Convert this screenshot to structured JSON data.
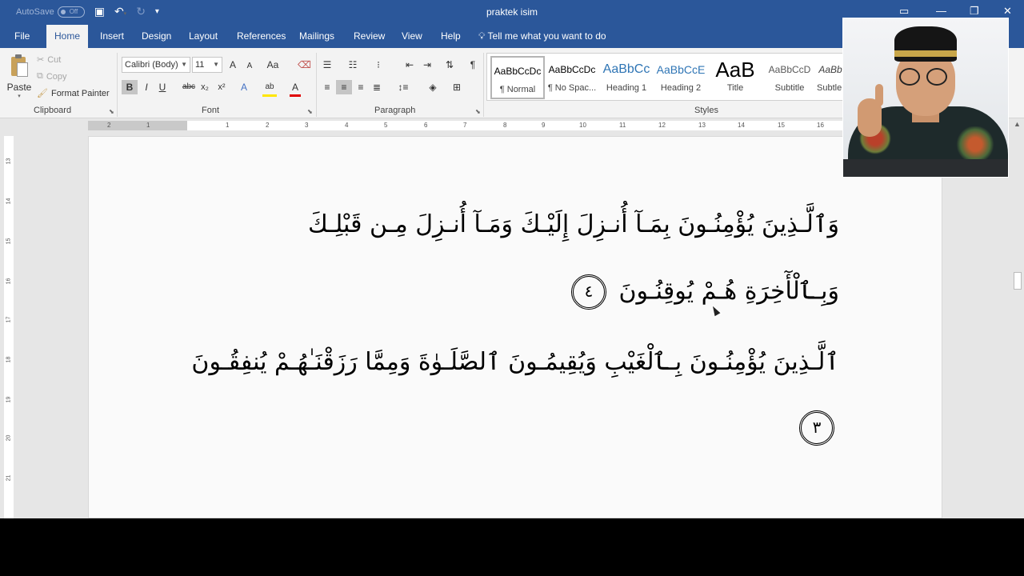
{
  "app": {
    "doc_title": "praktek isim",
    "autosave_label": "AutoSave",
    "autosave_state": "Off"
  },
  "tabs": [
    {
      "label": "File"
    },
    {
      "label": "Home"
    },
    {
      "label": "Insert"
    },
    {
      "label": "Design"
    },
    {
      "label": "Layout"
    },
    {
      "label": "References"
    },
    {
      "label": "Mailings"
    },
    {
      "label": "Review"
    },
    {
      "label": "View"
    },
    {
      "label": "Help"
    }
  ],
  "tell_me": "Tell me what you want to do",
  "clipboard": {
    "paste": "Paste",
    "cut": "Cut",
    "copy": "Copy",
    "format_painter": "Format Painter",
    "group_label": "Clipboard"
  },
  "font": {
    "font_name": "Calibri (Body)",
    "font_size": "11",
    "group_label": "Font",
    "bold": "B",
    "italic": "I",
    "underline": "U",
    "strike": "abc",
    "subscript": "x₂",
    "superscript": "x²",
    "grow": "A",
    "shrink": "A",
    "case": "Aa",
    "effects": "A",
    "highlight": "ab",
    "color": "A"
  },
  "paragraph": {
    "group_label": "Paragraph"
  },
  "styles": {
    "group_label": "Styles",
    "items": [
      {
        "sample": "AaBbCcDc",
        "name": "¶ Normal"
      },
      {
        "sample": "AaBbCcDc",
        "name": "¶ No Spac..."
      },
      {
        "sample": "AaBbCc",
        "name": "Heading 1"
      },
      {
        "sample": "AaBbCcE",
        "name": "Heading 2"
      },
      {
        "sample": "AaB",
        "name": "Title"
      },
      {
        "sample": "AaBbCcD",
        "name": "Subtitle"
      },
      {
        "sample": "AaBb",
        "name": "Subtle..."
      }
    ]
  },
  "ruler": {
    "numbers": [
      "2",
      "1",
      "1",
      "2",
      "3",
      "4",
      "5",
      "6",
      "7",
      "8",
      "9",
      "10",
      "11",
      "12",
      "13",
      "14",
      "15",
      "16"
    ],
    "vnumbers": [
      "13",
      "14",
      "15",
      "16",
      "17",
      "18",
      "19",
      "20",
      "21"
    ]
  },
  "document": {
    "line1": "وَٱلَّـذِينَ يُؤْمِنُـونَ بِمَـآ أُنـزِلَ إِلَيْـكَ وَمَـآ أُنـزِلَ مِـن قَبْلِـكَ",
    "line2": "وَبِـٱلْأٓخِرَةِ هُـمْ يُوقِنُـونَ",
    "marker1": "٤",
    "line3": "ٱلَّـذِينَ يُؤْمِنُـونَ بِـٱلْغَيْبِ وَيُقِيمُـونَ ٱلصَّلَـوٰةَ وَمِمَّا رَزَقْنَـٰهُـمْ يُنفِقُـونَ",
    "marker2": "٣"
  },
  "colors": {
    "accent": "#2b579a",
    "ribbon": "#f3f3f3"
  }
}
